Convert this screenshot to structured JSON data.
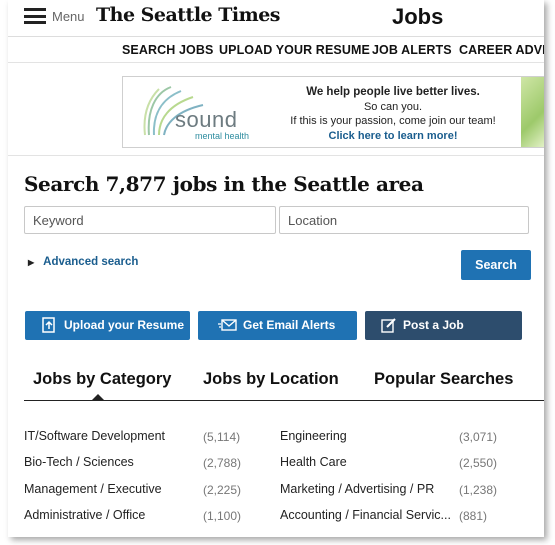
{
  "header": {
    "menu_label": "Menu",
    "logo": "The Seattle Times",
    "section_title": "Jobs"
  },
  "subnav": [
    "SEARCH JOBS",
    "UPLOAD YOUR RESUME",
    "JOB ALERTS",
    "CAREER ADVICE"
  ],
  "ad": {
    "brand": "sound",
    "brand_sub": "mental health",
    "line1": "We help people live better lives.",
    "line2": "So can you.",
    "line3": "If this is your passion, come join our team!",
    "link": "Click here to learn more!"
  },
  "search": {
    "headline": "Search 7,877 jobs in the Seattle area",
    "keyword_placeholder": "Keyword",
    "location_placeholder": "Location",
    "advanced": "Advanced search",
    "button": "Search"
  },
  "actions": {
    "upload": "Upload your Resume",
    "alerts": "Get Email Alerts",
    "post": "Post a Job",
    "colors": {
      "blue": "#1f72b3",
      "navy": "#2d4d6d"
    }
  },
  "tabs": [
    "Jobs by Category",
    "Jobs by Location",
    "Popular Searches"
  ],
  "categories": [
    {
      "left": {
        "name": "IT/Software Development",
        "count": "(5,114)"
      },
      "right": {
        "name": "Engineering",
        "count": "(3,071)"
      }
    },
    {
      "left": {
        "name": "Bio-Tech / Sciences",
        "count": "(2,788)"
      },
      "right": {
        "name": "Health Care",
        "count": "(2,550)"
      }
    },
    {
      "left": {
        "name": "Management / Executive",
        "count": "(2,225)"
      },
      "right": {
        "name": "Marketing / Advertising / PR",
        "count": "(1,238)"
      }
    },
    {
      "left": {
        "name": "Administrative / Office",
        "count": "(1,100)"
      },
      "right": {
        "name": "Accounting / Financial Servic...",
        "count": "(881)"
      }
    }
  ]
}
